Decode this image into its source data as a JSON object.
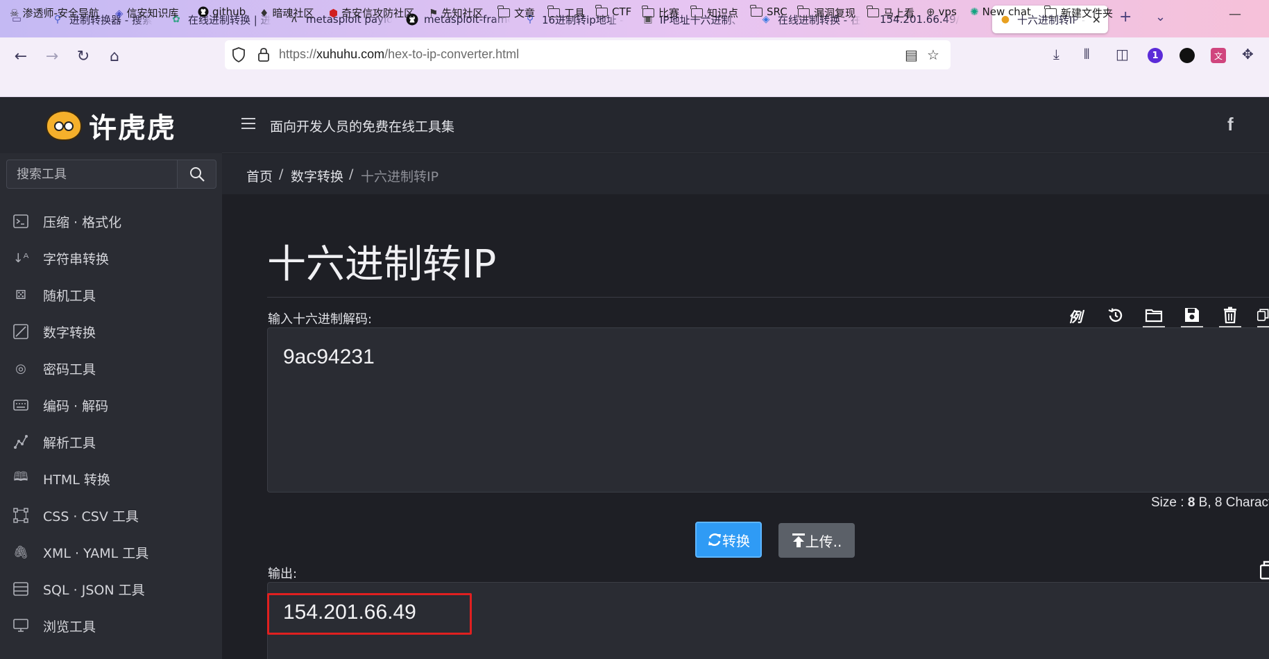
{
  "browser": {
    "tabs": [
      {
        "label": "进制转换器 - 搜索",
        "icon": "search-icon"
      },
      {
        "label": "在线进制转换 | 进",
        "icon": "gear-icon"
      },
      {
        "label": "metasploit payloa",
        "icon": "metasploit-icon"
      },
      {
        "label": "metasploit-framew",
        "icon": "github-icon"
      },
      {
        "label": "16进制转ip地址 -",
        "icon": "search-icon"
      },
      {
        "label": "IP地址十六进制、",
        "icon": "toolbox-icon"
      },
      {
        "label": "在线进制转换 - 在",
        "icon": "tool-icon"
      },
      {
        "label": "154.201.66.49/",
        "icon": ""
      },
      {
        "label": "十六进制转IP -",
        "icon": "tiger-icon",
        "active": true
      }
    ],
    "url_prefix": "https://",
    "url_host": "xuhuhu.com",
    "url_path": "/hex-to-ip-converter.html",
    "bookmarks": [
      {
        "label": "渗透师-安全导航",
        "icon": "skull-icon"
      },
      {
        "label": "信安知识库",
        "icon": "diamond-icon"
      },
      {
        "label": "github",
        "icon": "github-icon"
      },
      {
        "label": "暗魂社区",
        "icon": "flame-icon"
      },
      {
        "label": "奇安信攻防社区",
        "icon": "shield-icon"
      },
      {
        "label": "先知社区",
        "icon": "flag-icon"
      },
      {
        "label": "文章",
        "icon": "folder-icon"
      },
      {
        "label": "工具",
        "icon": "folder-icon"
      },
      {
        "label": "CTF",
        "icon": "folder-icon"
      },
      {
        "label": "比赛",
        "icon": "folder-icon"
      },
      {
        "label": "知识点",
        "icon": "folder-icon"
      },
      {
        "label": "SRC",
        "icon": "folder-icon"
      },
      {
        "label": "漏洞复现",
        "icon": "folder-icon"
      },
      {
        "label": "马上看",
        "icon": "folder-icon"
      },
      {
        "label": "vps",
        "icon": "globe-icon"
      },
      {
        "label": "New chat",
        "icon": "chatgpt-icon"
      },
      {
        "label": "新建文件夹",
        "icon": "folder-icon"
      }
    ],
    "badge_count": "1"
  },
  "site": {
    "logo_text": "许虎虎",
    "tagline": "面向开发人员的免费在线工具集",
    "search_placeholder": "搜索工具",
    "menu": [
      {
        "label": "压缩 · 格式化",
        "icon": "terminal-icon"
      },
      {
        "label": "字符串转换",
        "icon": "sort-icon"
      },
      {
        "label": "随机工具",
        "icon": "dice-icon"
      },
      {
        "label": "数字转换",
        "icon": "square-slash-icon"
      },
      {
        "label": "密码工具",
        "icon": "fingerprint-icon"
      },
      {
        "label": "编码 · 解码",
        "icon": "keyboard-icon"
      },
      {
        "label": "解析工具",
        "icon": "graph-icon"
      },
      {
        "label": "HTML 转换",
        "icon": "book-icon"
      },
      {
        "label": "CSS · CSV 工具",
        "icon": "bezier-icon"
      },
      {
        "label": "XML · YAML 工具",
        "icon": "paperclip-icon"
      },
      {
        "label": "SQL · JSON 工具",
        "icon": "table-icon"
      },
      {
        "label": "浏览工具",
        "icon": "monitor-icon"
      }
    ]
  },
  "breadcrumb": {
    "home": "首页",
    "section": "数字转换",
    "current": "十六进制转IP",
    "sep": "/"
  },
  "main": {
    "title": "十六进制转IP",
    "input_label": "输入十六进制解码:",
    "example_label": "例",
    "input_value": "9ac94231",
    "size_prefix": "Size : ",
    "size_bytes": "8",
    "size_mid": " B, ",
    "size_chars": "8",
    "size_suffix": " Charact",
    "convert_label": "转换",
    "upload_label": "上传..",
    "output_label": "输出:",
    "output_value": "154.201.66.49"
  }
}
